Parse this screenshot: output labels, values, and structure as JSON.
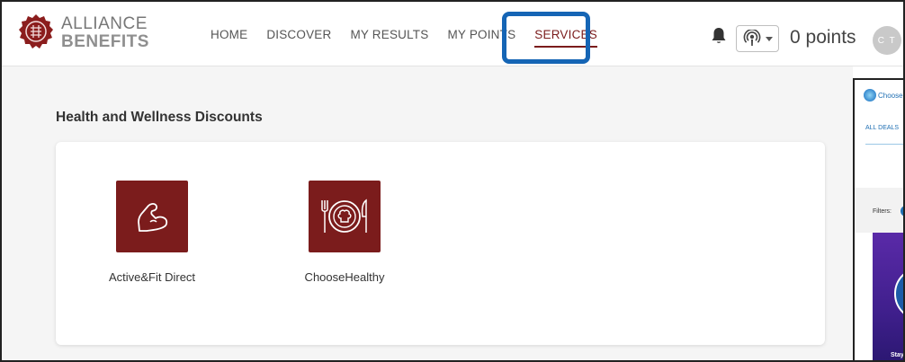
{
  "brand": {
    "line1": "ALLIANCE",
    "line2": "BENEFITS",
    "logo_icon": "alliance-seal-icon",
    "color": "#8b1d1d"
  },
  "nav": {
    "items": [
      {
        "label": "HOME"
      },
      {
        "label": "DISCOVER"
      },
      {
        "label": "MY RESULTS"
      },
      {
        "label": "MY POINTS"
      },
      {
        "label": "SERVICES",
        "active": true
      }
    ],
    "highlight_color": "#1565b5"
  },
  "header_right": {
    "bell_icon": "bell-icon",
    "podcast_icon": "podcast-icon",
    "points_label": "0 points",
    "avatar_initials": "C T"
  },
  "main": {
    "section_title": "Health and Wellness Discounts",
    "tiles": [
      {
        "label": "Active&Fit Direct",
        "icon": "flexed-arm-icon"
      },
      {
        "label": "ChooseHealthy",
        "icon": "plate-fork-knife-icon"
      }
    ],
    "tile_color": "#7b1c1c"
  },
  "preview": {
    "logo_text": "ChooseH",
    "tab_label": "ALL DEALS",
    "filters_label": "Filters:",
    "banner_text": "Stay"
  }
}
